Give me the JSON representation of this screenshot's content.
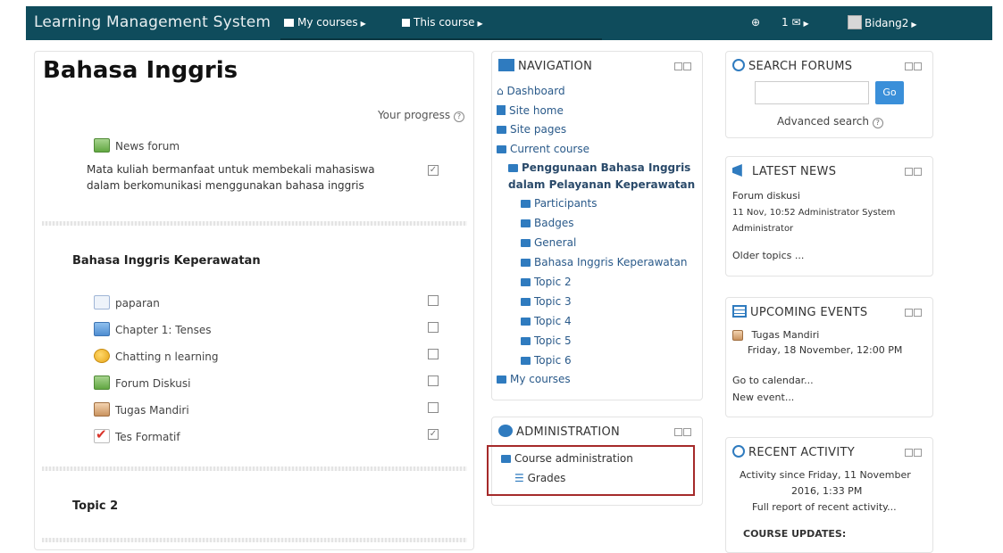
{
  "navbar": {
    "brand": "Learning Management System",
    "my_courses": "My courses",
    "this_course": "This course",
    "messages_count": "1",
    "user": "Bidang2"
  },
  "course": {
    "title": "Bahasa Inggris",
    "progress_label": "Your progress",
    "news_forum": "News forum",
    "summary": "Mata kuliah bermanfaat untuk membekali mahasiswa dalam berkomunikasi menggunakan bahasa inggris",
    "section1_title": "Bahasa Inggris Keperawatan",
    "activities": [
      {
        "label": "paparan",
        "done": false
      },
      {
        "label": "Chapter 1: Tenses",
        "done": false
      },
      {
        "label": "Chatting n learning",
        "done": false
      },
      {
        "label": "Forum Diskusi",
        "done": false
      },
      {
        "label": "Tugas Mandiri",
        "done": false
      },
      {
        "label": "Tes Formatif",
        "done": true
      }
    ],
    "section2_title": "Topic 2"
  },
  "navigation": {
    "title": "NAVIGATION",
    "dashboard": "Dashboard",
    "site_home": "Site home",
    "site_pages": "Site pages",
    "current_course": "Current course",
    "course_name_line1": "Penggunaan Bahasa Inggris",
    "course_name_line2": "dalam Pelayanan Keperawatan",
    "items": [
      "Participants",
      "Badges",
      "General",
      "Bahasa Inggris Keperawatan",
      "Topic 2",
      "Topic 3",
      "Topic 4",
      "Topic 5",
      "Topic 6"
    ],
    "my_courses": "My courses"
  },
  "administration": {
    "title": "ADMINISTRATION",
    "course_admin": "Course administration",
    "grades": "Grades"
  },
  "search_forums": {
    "title": "SEARCH FORUMS",
    "go": "Go",
    "advanced": "Advanced search"
  },
  "latest_news": {
    "title": "LATEST NEWS",
    "item_title": "Forum diskusi",
    "item_meta": "11 Nov, 10:52 Administrator System",
    "item_meta2": "Administrator",
    "older": "Older topics ..."
  },
  "upcoming_events": {
    "title": "UPCOMING EVENTS",
    "event_name": "Tugas Mandiri",
    "event_time": "Friday, 18 November, 12:00 PM",
    "goto": "Go to calendar...",
    "new_event": "New event..."
  },
  "recent_activity": {
    "title": "RECENT ACTIVITY",
    "since_line1": "Activity since Friday, 11 November",
    "since_line2": "2016, 1:33 PM",
    "full_report": "Full report of recent activity...",
    "updates": "COURSE UPDATES:"
  }
}
